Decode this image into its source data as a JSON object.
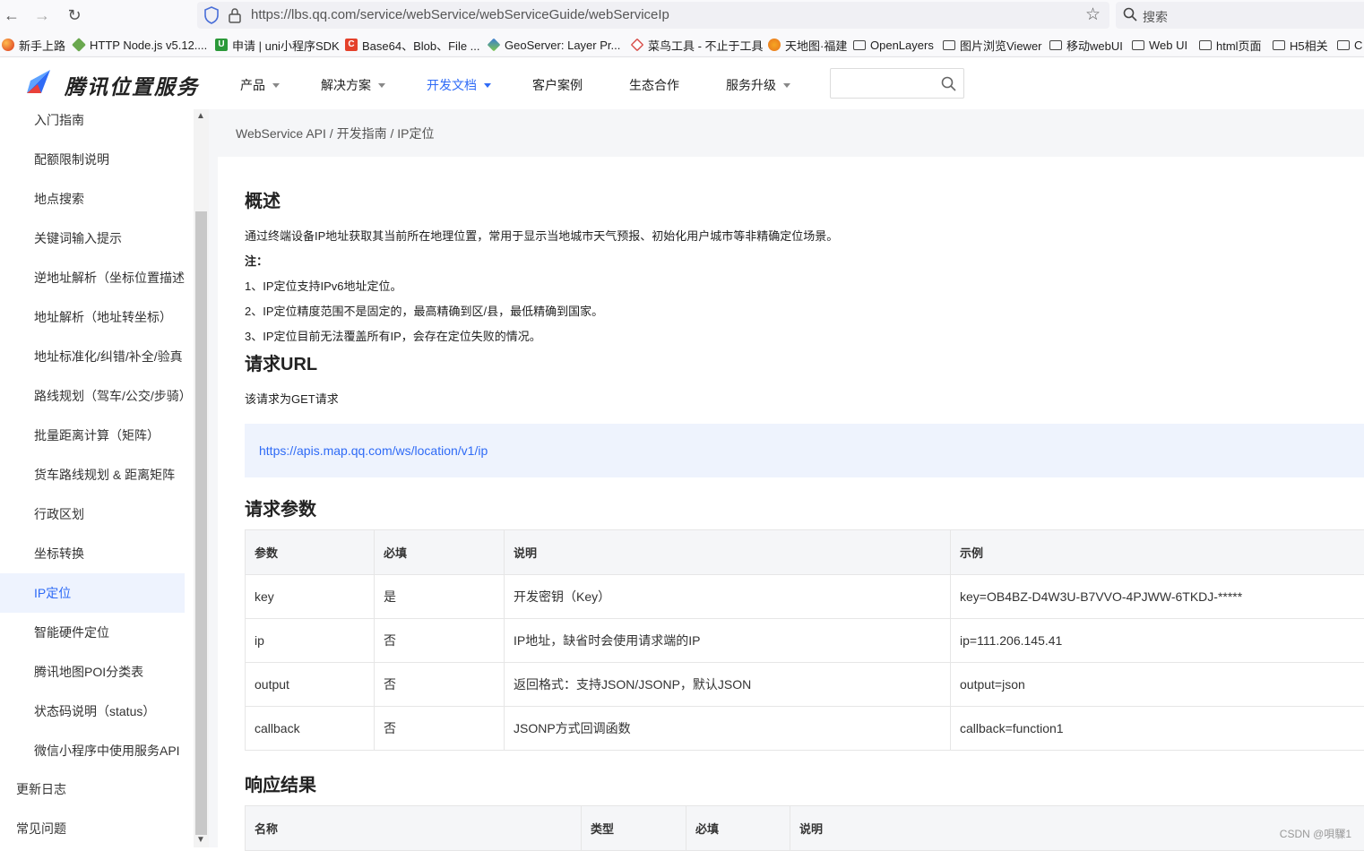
{
  "browser": {
    "url": "https://lbs.qq.com/service/webService/webServiceGuide/webServiceIp",
    "search_placeholder": "搜索"
  },
  "bookmarks": [
    {
      "label": "新手上路",
      "icon": "firefox-icon",
      "color": "#e55b2d"
    },
    {
      "label": "HTTP Node.js v5.12....",
      "icon": "nodejs-icon",
      "color": "#6aa84f"
    },
    {
      "label": "申请 | uni小程序SDK",
      "icon": "uni-icon",
      "color": "#2b9939"
    },
    {
      "label": "Base64、Blob、File ...",
      "icon": "csdn-icon",
      "color": "#e4412b"
    },
    {
      "label": "GeoServer: Layer Pr...",
      "icon": "geoserver-icon",
      "color": "#3a7bd5"
    },
    {
      "label": "菜鸟工具 - 不止于工具",
      "icon": "runoob-icon",
      "color": "#d9534f"
    },
    {
      "label": "天地图·福建",
      "icon": "tianditu-icon",
      "color": "#f5a623"
    },
    {
      "label": "OpenLayers",
      "icon": "folder-icon"
    },
    {
      "label": "图片浏览Viewer",
      "icon": "folder-icon"
    },
    {
      "label": "移动webUI",
      "icon": "folder-icon"
    },
    {
      "label": "Web UI",
      "icon": "folder-icon"
    },
    {
      "label": "html页面",
      "icon": "folder-icon"
    },
    {
      "label": "H5相关",
      "icon": "folder-icon"
    },
    {
      "label": "C",
      "icon": "folder-icon"
    }
  ],
  "header": {
    "brand": "腾讯位置服务",
    "nav": [
      {
        "label": "产品",
        "dropdown": true,
        "active": false
      },
      {
        "label": "解决方案",
        "dropdown": true,
        "active": false
      },
      {
        "label": "开发文档",
        "dropdown": true,
        "active": true
      },
      {
        "label": "客户案例",
        "dropdown": false,
        "active": false
      },
      {
        "label": "生态合作",
        "dropdown": false,
        "active": false
      },
      {
        "label": "服务升级",
        "dropdown": true,
        "active": false
      }
    ],
    "accent_color": "#2f6bf6"
  },
  "sidebar": {
    "items": [
      {
        "label": "入门指南"
      },
      {
        "label": "配额限制说明"
      },
      {
        "label": "地点搜索"
      },
      {
        "label": "关键词输入提示"
      },
      {
        "label": "逆地址解析（坐标位置描述）"
      },
      {
        "label": "地址解析（地址转坐标）"
      },
      {
        "label": "地址标准化/纠错/补全/验真"
      },
      {
        "label": "路线规划（驾车/公交/步骑）"
      },
      {
        "label": "批量距离计算（矩阵）"
      },
      {
        "label": "货车路线规划 & 距离矩阵"
      },
      {
        "label": "行政区划"
      },
      {
        "label": "坐标转换"
      },
      {
        "label": "IP定位",
        "active": true
      },
      {
        "label": "智能硬件定位"
      },
      {
        "label": "腾讯地图POI分类表"
      },
      {
        "label": "状态码说明（status）"
      },
      {
        "label": "微信小程序中使用服务API"
      },
      {
        "label": "更新日志",
        "top": true
      },
      {
        "label": "常见问题",
        "top": true
      }
    ]
  },
  "breadcrumb": "WebService API / 开发指南 / IP定位",
  "content": {
    "overview_title": "概述",
    "overview_text": "通过终端设备IP地址获取其当前所在地理位置，常用于显示当地城市天气预报、初始化用户城市等非精确定位场景。",
    "note_label": "注：",
    "notes": [
      "1、IP定位支持IPv6地址定位。",
      "2、IP定位精度范围不是固定的，最高精确到区/县，最低精确到国家。",
      "3、IP定位目前无法覆盖所有IP，会存在定位失败的情况。"
    ],
    "url_title": "请求URL",
    "url_desc": "该请求为GET请求",
    "request_url": "https://apis.map.qq.com/ws/location/v1/ip",
    "params_title": "请求参数",
    "params_headers": [
      "参数",
      "必填",
      "说明",
      "示例"
    ],
    "params_rows": [
      [
        "key",
        "是",
        "开发密钥（Key）",
        "key=OB4BZ-D4W3U-B7VVO-4PJWW-6TKDJ-*****"
      ],
      [
        "ip",
        "否",
        "IP地址，缺省时会使用请求端的IP",
        "ip=111.206.145.41"
      ],
      [
        "output",
        "否",
        "返回格式：支持JSON/JSONP，默认JSON",
        "output=json"
      ],
      [
        "callback",
        "否",
        "JSONP方式回调函数",
        "callback=function1"
      ]
    ],
    "response_title": "响应结果",
    "response_headers": [
      "名称",
      "类型",
      "必填",
      "说明"
    ]
  },
  "watermark": "CSDN @唄驟1"
}
